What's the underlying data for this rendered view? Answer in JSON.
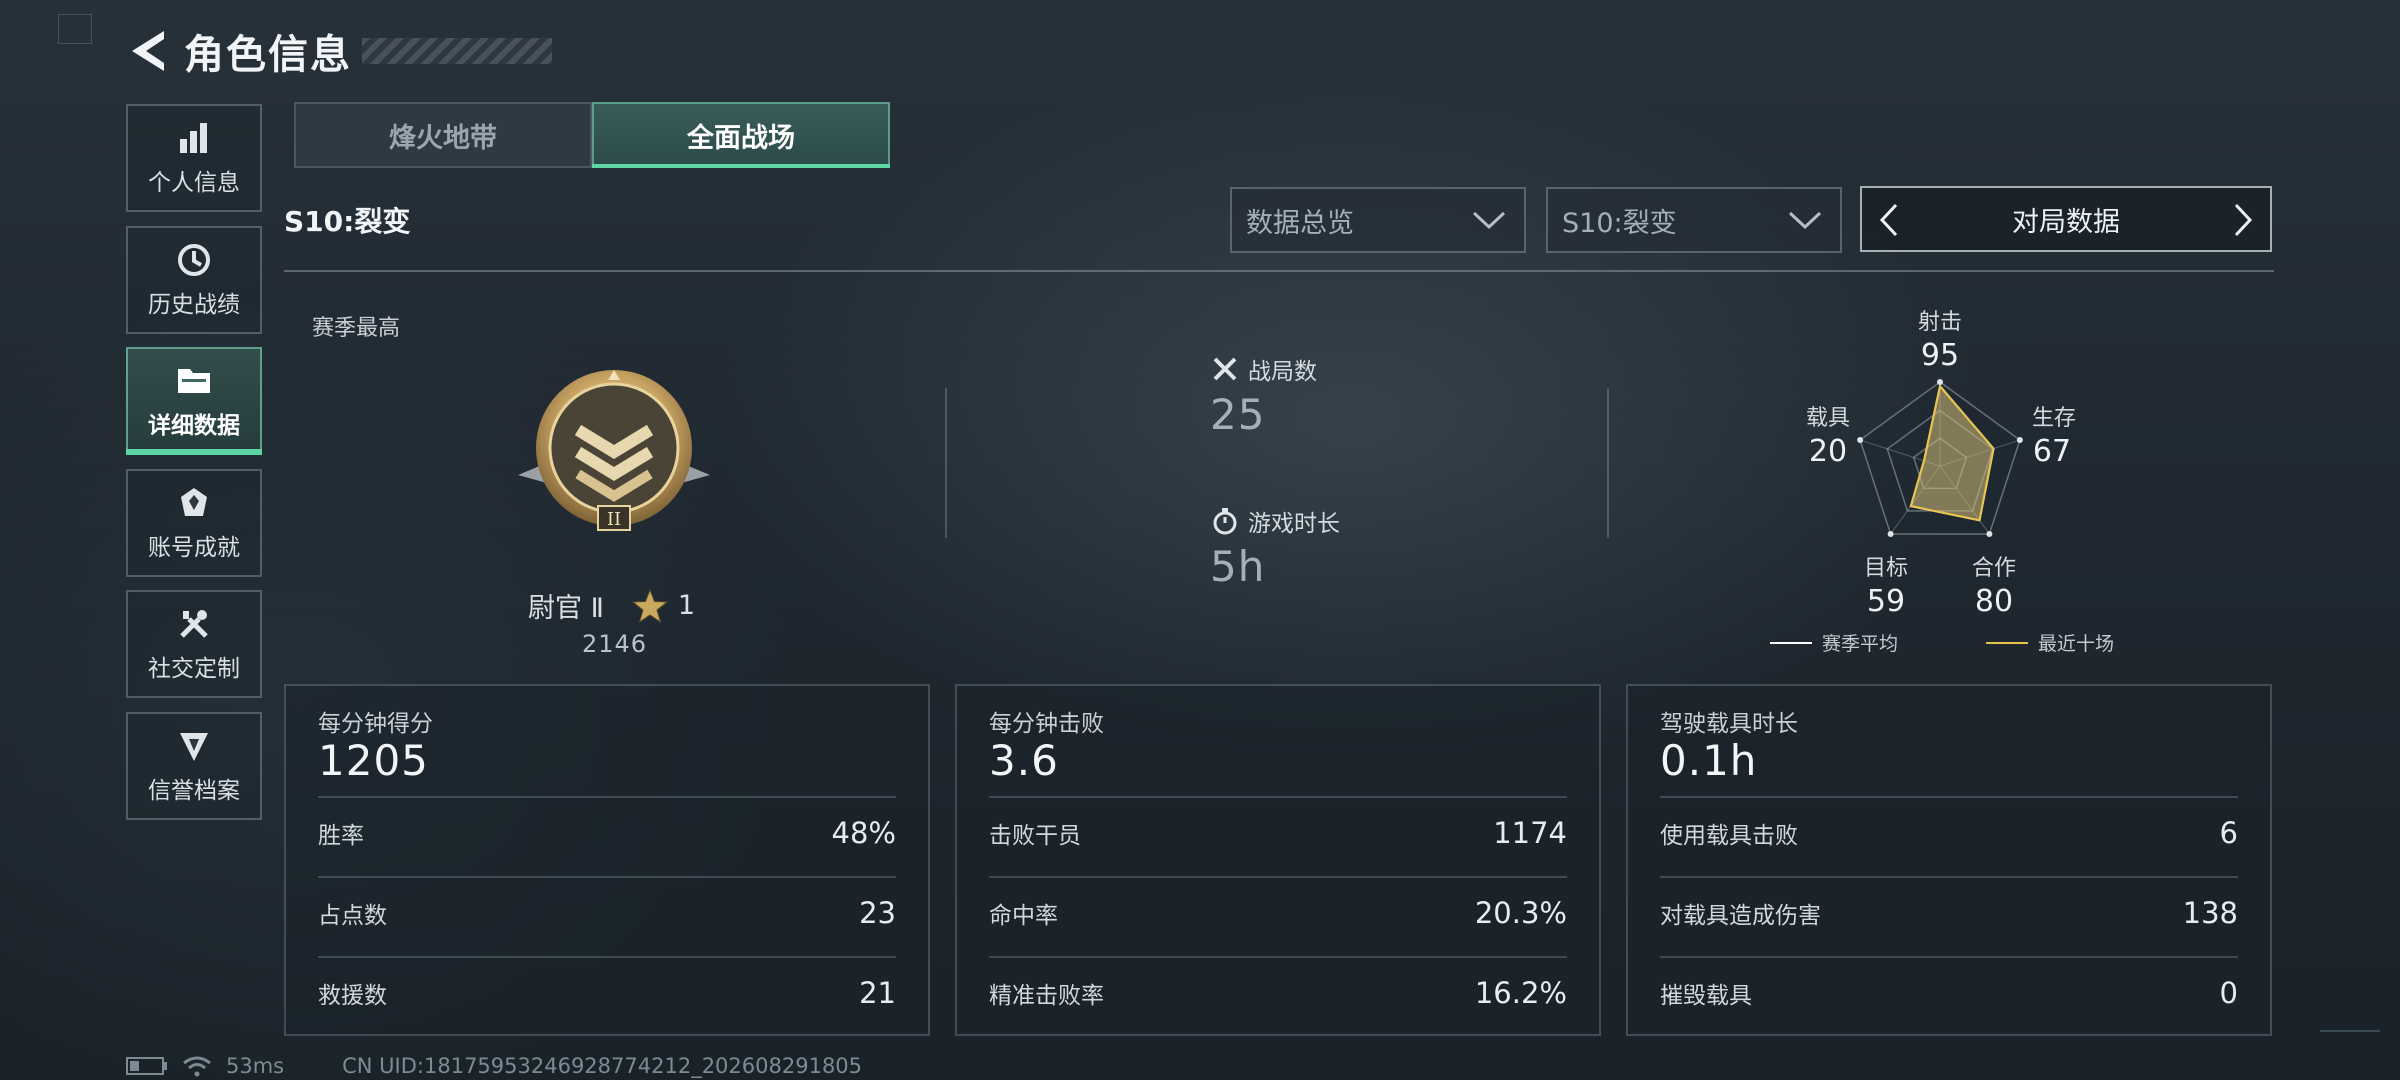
{
  "header": {
    "title": "角色信息"
  },
  "sidebar": {
    "items": [
      {
        "label": "个人信息",
        "icon": "bar-chart-icon",
        "active": false
      },
      {
        "label": "历史战绩",
        "icon": "history-icon",
        "active": false
      },
      {
        "label": "详细数据",
        "icon": "folder-icon",
        "active": true
      },
      {
        "label": "账号成就",
        "icon": "achievement-icon",
        "active": false
      },
      {
        "label": "社交定制",
        "icon": "wrench-screwdriver-icon",
        "active": false
      },
      {
        "label": "信誉档案",
        "icon": "credit-shield-icon",
        "active": false
      }
    ]
  },
  "tabs": [
    {
      "label": "烽火地带",
      "active": false
    },
    {
      "label": "全面战场",
      "active": true
    }
  ],
  "season": {
    "name": "S10:裂变"
  },
  "filters": {
    "overview": "数据总览",
    "season_select": "S10:裂变",
    "switcher": "对局数据"
  },
  "rank": {
    "label": "赛季最高",
    "name": "尉官 Ⅱ",
    "stars": "1",
    "points": "2146",
    "emblem_numeral": "II"
  },
  "summary": {
    "battles_label": "战局数",
    "battles_value": "25",
    "playtime_label": "游戏时长",
    "playtime_value": "5h"
  },
  "radar": {
    "axes": [
      {
        "label": "射击",
        "value": "95"
      },
      {
        "label": "生存",
        "value": "67"
      },
      {
        "label": "合作",
        "value": "80"
      },
      {
        "label": "目标",
        "value": "59"
      },
      {
        "label": "载具",
        "value": "20"
      }
    ],
    "legend": [
      {
        "label": "赛季平均",
        "color": "#ffffff"
      },
      {
        "label": "最近十场",
        "color": "#e8c44a"
      }
    ]
  },
  "cards": [
    {
      "title": "每分钟得分",
      "main": "1205",
      "rows": [
        {
          "k": "胜率",
          "v": "48%"
        },
        {
          "k": "占点数",
          "v": "23"
        },
        {
          "k": "救援数",
          "v": "21"
        }
      ]
    },
    {
      "title": "每分钟击败",
      "main": "3.6",
      "rows": [
        {
          "k": "击败干员",
          "v": "1174"
        },
        {
          "k": "命中率",
          "v": "20.3%"
        },
        {
          "k": "精准击败率",
          "v": "16.2%"
        }
      ]
    },
    {
      "title": "驾驶载具时长",
      "main": "0.1h",
      "rows": [
        {
          "k": "使用载具击败",
          "v": "6"
        },
        {
          "k": "对载具造成伤害",
          "v": "138"
        },
        {
          "k": "摧毁载具",
          "v": "0"
        }
      ]
    }
  ],
  "status": {
    "ping": "53ms",
    "uid": "CN UID:18175953246928774212_202608291805"
  }
}
